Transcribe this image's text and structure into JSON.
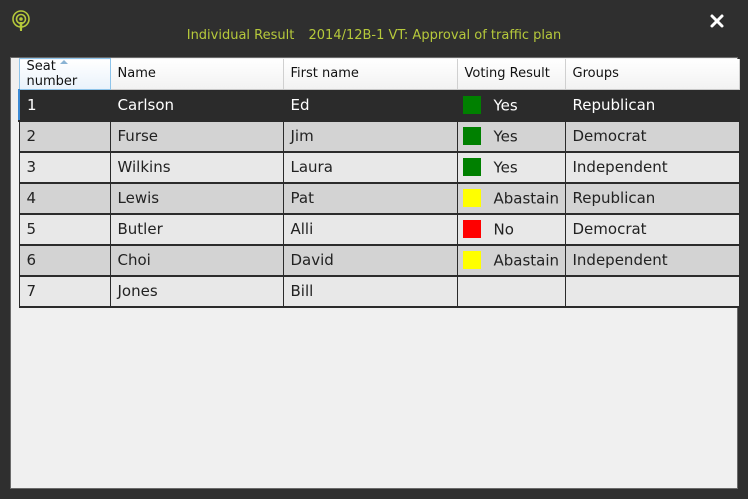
{
  "window": {
    "title_name": "Individual Result",
    "title_subject": "2014/12B-1 VT: Approval of traffic plan",
    "app_icon": "broadcast-icon",
    "close_icon": "close-icon"
  },
  "table": {
    "columns": [
      "Seat number",
      "Name",
      "First name",
      "Voting Result",
      "Groups"
    ],
    "sorted_column": "Seat number",
    "selected_row": 0,
    "rows": [
      {
        "seat": "1",
        "name": "Carlson",
        "first": "Ed",
        "vote": "Yes",
        "vote_color": "#008000",
        "group": "Republican"
      },
      {
        "seat": "2",
        "name": "Furse",
        "first": "Jim",
        "vote": "Yes",
        "vote_color": "#008000",
        "group": "Democrat"
      },
      {
        "seat": "3",
        "name": "Wilkins",
        "first": "Laura",
        "vote": "Yes",
        "vote_color": "#008000",
        "group": "Independent"
      },
      {
        "seat": "4",
        "name": "Lewis",
        "first": "Pat",
        "vote": "Abastain",
        "vote_color": "#ffff00",
        "group": "Republican"
      },
      {
        "seat": "5",
        "name": "Butler",
        "first": "Alli",
        "vote": "No",
        "vote_color": "#ff0000",
        "group": "Democrat"
      },
      {
        "seat": "6",
        "name": "Choi",
        "first": "David",
        "vote": "Abastain",
        "vote_color": "#ffff00",
        "group": "Independent"
      },
      {
        "seat": "7",
        "name": "Jones",
        "first": "Bill",
        "vote": "",
        "vote_color": "",
        "group": ""
      }
    ]
  },
  "colors": {
    "title": "#b6c93b",
    "background": "#2f2f2f",
    "selected_row": "#2b2b2b"
  }
}
